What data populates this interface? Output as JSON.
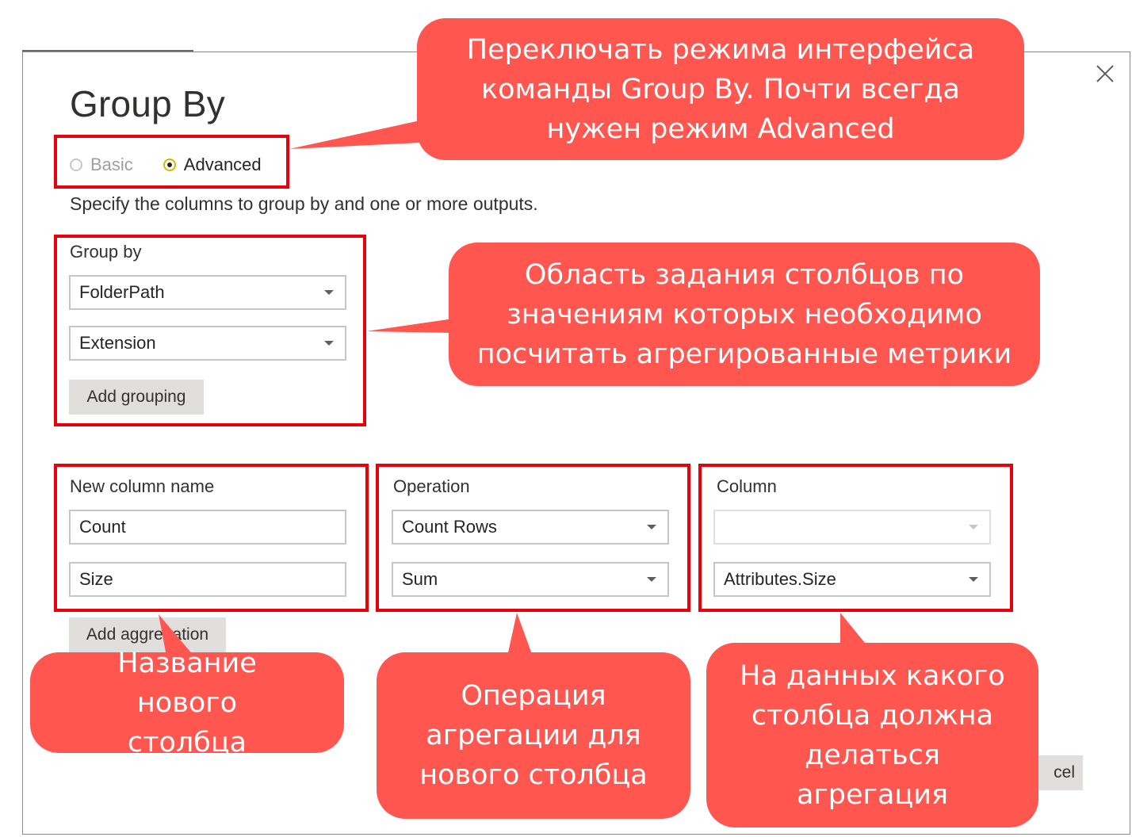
{
  "dialog": {
    "title": "Group By",
    "mode": {
      "basic_label": "Basic",
      "advanced_label": "Advanced",
      "selected": "Advanced"
    },
    "description": "Specify the columns to group by and one or more outputs.",
    "group_by": {
      "label": "Group by",
      "selects": [
        "FolderPath",
        "Extension"
      ],
      "add_button": "Add grouping"
    },
    "aggregations": {
      "name_label": "New column name",
      "operation_label": "Operation",
      "column_label": "Column",
      "rows": [
        {
          "name": "Count",
          "operation": "Count Rows",
          "column": ""
        },
        {
          "name": "Size",
          "operation": "Sum",
          "column": "Attributes.Size"
        }
      ],
      "add_button": "Add aggregation"
    },
    "cancel_partial": "cel"
  },
  "callouts": {
    "mode": "Переключать режима интерфейса команды Group By. Почти всегда нужен режим Advanced",
    "group_by": "Область задания столбцов по значениям которых необходимо посчитать агрегированные метрики",
    "name": "Название нового столбца",
    "operation": "Операция агрегации для нового столбца",
    "column": "На данных какого столбца должна делаться агрегация"
  },
  "colors": {
    "callout_bg": "#ff5650",
    "frame": "#e8000a",
    "radio_accent": "#d8b700"
  },
  "icons": [
    "close-icon",
    "chevron-down-icon",
    "radio-icon"
  ]
}
